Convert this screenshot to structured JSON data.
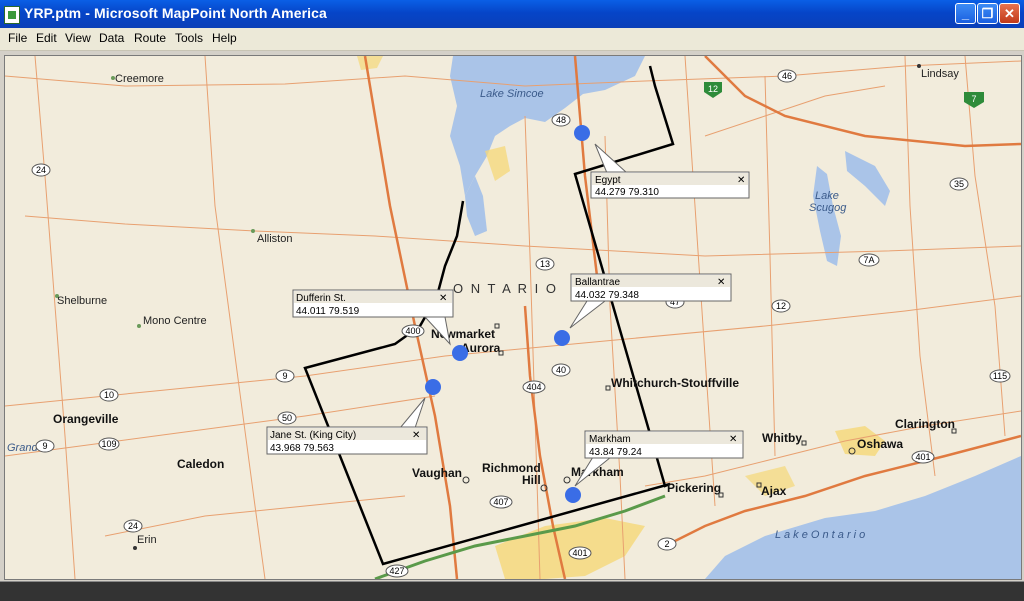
{
  "window": {
    "title": "YRP.ptm - Microsoft MapPoint North America"
  },
  "menu": [
    "File",
    "Edit",
    "View",
    "Data",
    "Route",
    "Tools",
    "Help"
  ],
  "map": {
    "region_label": "O N T A R I O",
    "water": {
      "lake_simcoe": "Lake Simcoe",
      "lake_scugog_1": "Lake",
      "lake_scugog_2": "Scugog",
      "lake_ontario": "L a k e     O n t a r i o",
      "grand": "Grand"
    },
    "places": {
      "creemore": "Creemore",
      "alliston": "Alliston",
      "shelburne": "Shelburne",
      "mono_centre": "Mono Centre",
      "orangeville": "Orangeville",
      "caledon": "Caledon",
      "erin": "Erin",
      "lindsay": "Lindsay",
      "newmarket": "Newmarket",
      "aurora": "Aurora",
      "whitchurch": "Whitchurch-Stouffville",
      "vaughan": "Vaughan",
      "richmond_1": "Richmond",
      "richmond_2": "Hill",
      "markham": "Markham",
      "pickering": "Pickering",
      "ajax": "Ajax",
      "whitby": "Whitby",
      "oshawa": "Oshawa",
      "clarington": "Clarington"
    },
    "shields": {
      "h24a": "24",
      "h48": "48",
      "h46": "46",
      "h12a": "12",
      "h7a": "7",
      "h35": "35",
      "h13": "13",
      "h7A": "7A",
      "h12b": "12",
      "h400": "400",
      "h9": "9",
      "h40": "40",
      "h404": "404",
      "h47": "47",
      "h115": "115",
      "h10": "10",
      "h50": "50",
      "h109": "109",
      "h9b": "9",
      "h24b": "24",
      "h407": "407",
      "h401a": "401",
      "h401b": "401",
      "h2": "2",
      "h427": "427"
    },
    "callouts": [
      {
        "name": "Egypt",
        "coords": "44.279 79.310"
      },
      {
        "name": "Ballantrae",
        "coords": "44.032  79.348"
      },
      {
        "name": "Dufferin St.",
        "coords": "44.011  79.519"
      },
      {
        "name": "Jane St. (King City)",
        "coords": "43.968  79.563"
      },
      {
        "name": "Markham",
        "coords": "43.84  79.24"
      }
    ],
    "close_glyph": "✕"
  }
}
